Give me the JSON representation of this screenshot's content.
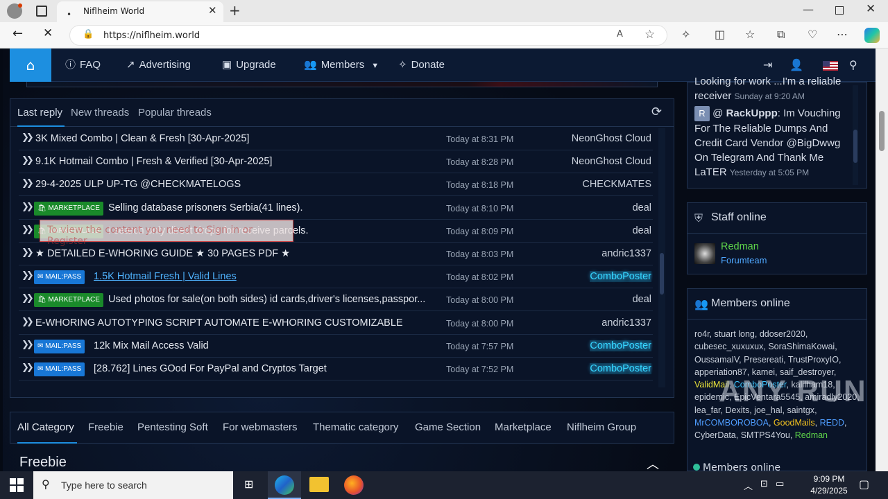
{
  "browser": {
    "tab_title": "Niflheim World",
    "url": "https://niflheim.world"
  },
  "navbar": {
    "faq": "FAQ",
    "advertising": "Advertising",
    "upgrade": "Upgrade",
    "members": "Members",
    "donate": "Donate"
  },
  "threads": {
    "tabs": [
      "Last reply",
      "New threads",
      "Popular threads"
    ],
    "rows": [
      {
        "prefix": "",
        "title": "3K Mixed Combo | Clean & Fresh [30-Apr-2025]",
        "time": "Today at 8:31 PM",
        "user": "NeonGhost Cloud"
      },
      {
        "prefix": "",
        "title": "9.1K Hotmail Combo | Fresh & Verified [30-Apr-2025]",
        "time": "Today at 8:28 PM",
        "user": "NeonGhost Cloud"
      },
      {
        "prefix": "",
        "title": "29-4-2025 ULP UP-TG @CHECKMATELOGS",
        "time": "Today at 8:18 PM",
        "user": "CHECKMATES"
      },
      {
        "prefix": "MARKETPLACE",
        "title": "Selling database prisoners Serbia(41 lines).",
        "time": "Today at 8:10 PM",
        "user": "deal"
      },
      {
        "prefix": "MARKETPLACE",
        "title": "I search only direct drops for receive parcels.",
        "time": "Today at 8:09 PM",
        "user": "deal"
      },
      {
        "prefix": "",
        "title": "★ DETAILED E-WHORING GUIDE ★ 30 PAGES PDF ★",
        "time": "Today at 8:03 PM",
        "user": "andric1337"
      },
      {
        "prefix": "MAIL:PASS",
        "title": "1.5K Hotmail Fresh | Valid Lines",
        "time": "Today at 8:02 PM",
        "user": "ComboPoster"
      },
      {
        "prefix": "MARKETPLACE",
        "title": "Used photos for sale(on both sides) id cards,driver's licenses,passpor...",
        "time": "Today at 8:00 PM",
        "user": "deal"
      },
      {
        "prefix": "",
        "title": "E-WHORING AUTOTYPING SCRIPT AUTOMATE E-WHORING CUSTOMIZABLE",
        "time": "Today at 8:00 PM",
        "user": "andric1337"
      },
      {
        "prefix": "MAIL:PASS",
        "title": "12k Mix Mail Access Valid",
        "time": "Today at 7:57 PM",
        "user": "ComboPoster"
      },
      {
        "prefix": "MAIL:PASS",
        "title": "[28.762] Lines GOod For PayPal and Cryptos Target",
        "time": "Today at 7:52 PM",
        "user": "ComboPoster"
      }
    ],
    "tooltip": "To view the content you need to Sign in or Register"
  },
  "categories": [
    "All Category",
    "Freebie",
    "Pentesting Soft",
    "For webmasters",
    "Thematic category",
    "Game Section",
    "Marketplace",
    "Niflheim Group"
  ],
  "freebie_heading": "Freebie",
  "shoutbox": {
    "line1": "Looking for work ...I'm a reliable receiver",
    "line1_time": "Sunday at 9:20 AM",
    "avatar_letter": "R",
    "at": "@",
    "user2": "RackUppp",
    "msg2": ": Im Vouching For The Reliable Dumps And Credit Card Vendor @BigDwwg On Telegram And Thank Me LaTER",
    "msg2_time": "Yesterday at 5:05 PM"
  },
  "staff_online": {
    "title": "Staff online",
    "name": "Redman",
    "role": "Forumteam"
  },
  "members_online": {
    "title": "Members online",
    "footer": "Members online",
    "list": [
      {
        "n": "ro4r",
        "c": ""
      },
      {
        "n": "stuart long",
        "c": ""
      },
      {
        "n": "ddoser2020",
        "c": ""
      },
      {
        "n": "cubesec_xuxuxux",
        "c": ""
      },
      {
        "n": "SoraShimaKowai",
        "c": ""
      },
      {
        "n": "OussamaIV",
        "c": ""
      },
      {
        "n": "Presereati",
        "c": ""
      },
      {
        "n": "TrustProxyIO",
        "c": ""
      },
      {
        "n": "apperiation87",
        "c": ""
      },
      {
        "n": "kamei",
        "c": ""
      },
      {
        "n": "saif_destroyer",
        "c": ""
      },
      {
        "n": "ValidMail",
        "c": "m-yellow"
      },
      {
        "n": "ComboPoster",
        "c": "m-cyan"
      },
      {
        "n": "kalilham18",
        "c": ""
      },
      {
        "n": "epidemic",
        "c": ""
      },
      {
        "n": "EpicVentara5545",
        "c": ""
      },
      {
        "n": "amiradly2020",
        "c": ""
      },
      {
        "n": "lea_far",
        "c": ""
      },
      {
        "n": "Dexits",
        "c": ""
      },
      {
        "n": "joe_hal",
        "c": ""
      },
      {
        "n": "saintgx",
        "c": ""
      },
      {
        "n": "MrCOMBOROBOA",
        "c": "m-blue"
      },
      {
        "n": "GoodMails",
        "c": "m-gold"
      },
      {
        "n": "REDD",
        "c": "m-blue"
      },
      {
        "n": "CyberData",
        "c": ""
      },
      {
        "n": "SMTPS4You",
        "c": ""
      },
      {
        "n": "Redman",
        "c": "m-green"
      }
    ]
  },
  "watermark": "ANY RUN",
  "taskbar": {
    "search_placeholder": "Type here to search",
    "time": "9:09 PM",
    "date": "4/29/2025"
  },
  "colors": {
    "accent": "#1d8fe0",
    "marketplace_prefix": "#1a8a2a",
    "mailpass_prefix": "#1877d6",
    "highlight_user": "#36d6ff"
  }
}
